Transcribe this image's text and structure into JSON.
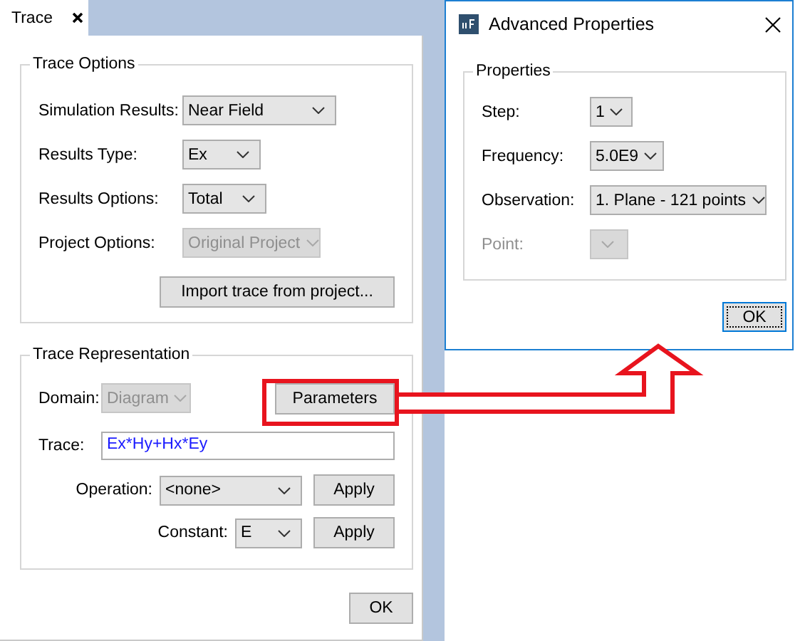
{
  "trace_window": {
    "tab": {
      "label": "Trace",
      "selected": true
    },
    "trace_options": {
      "title": "Trace Options",
      "fields": [
        {
          "label": "Simulation Results:",
          "value": "Near Field",
          "disabled": false
        },
        {
          "label": "Results Type:",
          "value": "Ex",
          "disabled": false
        },
        {
          "label": "Results Options:",
          "value": "Total",
          "disabled": false
        },
        {
          "label": "Project Options:",
          "value": "Original Project",
          "disabled": true
        }
      ],
      "import_button": "Import trace from project..."
    },
    "trace_representation": {
      "title": "Trace Representation",
      "domain": {
        "label": "Domain:",
        "value": "Diagram",
        "disabled": true
      },
      "parameters_button": "Parameters",
      "trace": {
        "label": "Trace:",
        "value": "Ex*Hy+Hx*Ey"
      },
      "operation": {
        "label": "Operation:",
        "value": "<none>",
        "button": "Apply"
      },
      "constant": {
        "label": "Constant:",
        "value": "E",
        "button": "Apply"
      }
    },
    "ok_button": "OK"
  },
  "dialog": {
    "title": "Advanced Properties",
    "group_title": "Properties",
    "fields": [
      {
        "label": "Step:",
        "value": "1",
        "disabled": false
      },
      {
        "label": "Frequency:",
        "value": "5.0E9",
        "disabled": false
      },
      {
        "label": "Observation:",
        "value": "1. Plane - 121 points",
        "disabled": false
      },
      {
        "label": "Point:",
        "disabled": true
      }
    ],
    "ok_button": {
      "label": "OK",
      "focused": true
    }
  }
}
